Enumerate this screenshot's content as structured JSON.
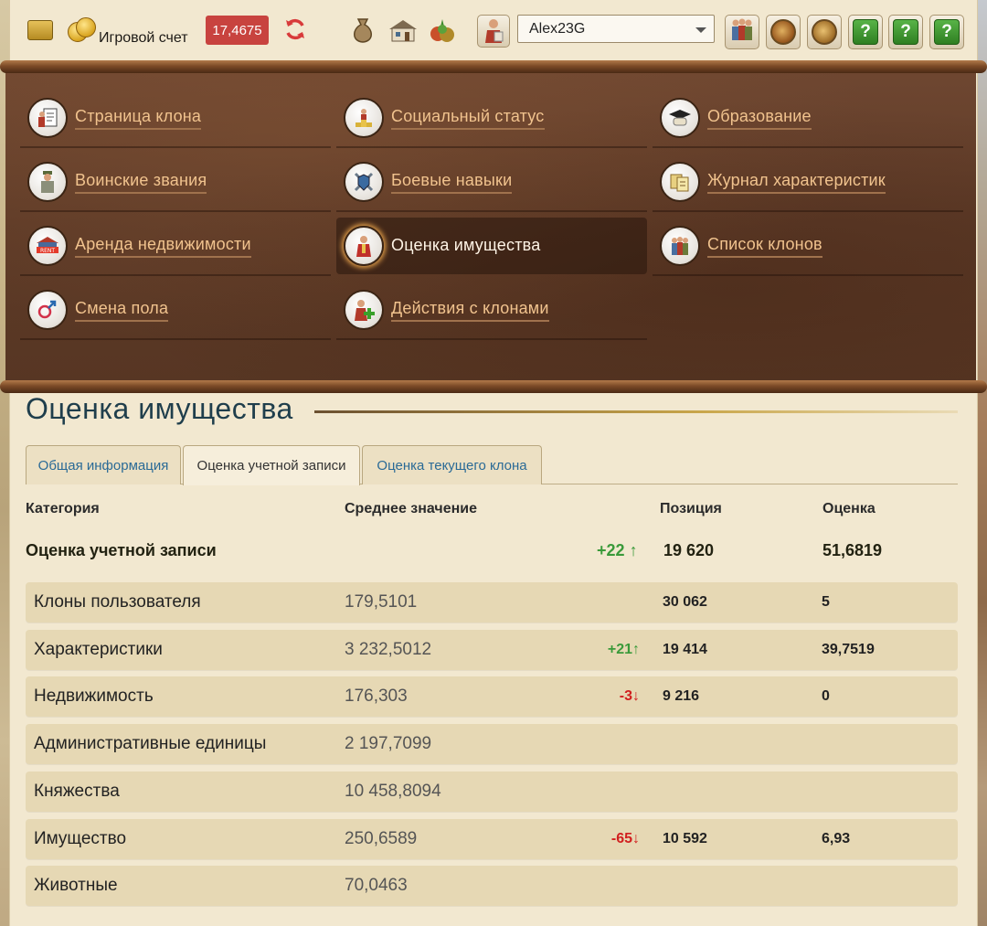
{
  "toolbar": {
    "account_label": "Игровой счет",
    "balance": "17,4675",
    "refresh_icon": "refresh-icon",
    "clone_name": "Alex23G",
    "help_icon_text": "?"
  },
  "menu": {
    "items": [
      {
        "label": "Страница клона",
        "icon": "clone-page-icon"
      },
      {
        "label": "Социальный статус",
        "icon": "social-status-icon"
      },
      {
        "label": "Образование",
        "icon": "education-icon"
      },
      {
        "label": "Воинские звания",
        "icon": "military-rank-icon"
      },
      {
        "label": "Боевые навыки",
        "icon": "combat-skills-icon"
      },
      {
        "label": "Журнал характеристик",
        "icon": "stats-journal-icon"
      },
      {
        "label": "Аренда недвижимости",
        "icon": "rent-icon"
      },
      {
        "label": "Оценка имущества",
        "icon": "property-valuation-icon",
        "active": true
      },
      {
        "label": "Список клонов",
        "icon": "clone-list-icon"
      },
      {
        "label": "Смена пола",
        "icon": "gender-change-icon"
      },
      {
        "label": "Действия с клонами",
        "icon": "clone-actions-icon"
      }
    ]
  },
  "page": {
    "title": "Оценка имущества"
  },
  "tabs": [
    {
      "label": "Общая информация",
      "active": false
    },
    {
      "label": "Оценка учетной записи",
      "active": true
    },
    {
      "label": "Оценка текущего клона",
      "active": false
    }
  ],
  "table": {
    "headers": {
      "category": "Категория",
      "average": "Среднее значение",
      "position": "Позиция",
      "score": "Оценка"
    },
    "summary": {
      "name": "Оценка учетной записи",
      "delta": "+22",
      "delta_dir": "up",
      "position": "19 620",
      "score": "51,6819"
    },
    "rows": [
      {
        "name": "Клоны пользователя",
        "average": "179,5101",
        "delta": "",
        "delta_dir": "",
        "position": "30 062",
        "score": "5"
      },
      {
        "name": "Характеристики",
        "average": "3 232,5012",
        "delta": "+21",
        "delta_dir": "up",
        "position": "19 414",
        "score": "39,7519"
      },
      {
        "name": "Недвижимость",
        "average": "176,303",
        "delta": "-3",
        "delta_dir": "down",
        "position": "9 216",
        "score": "0"
      },
      {
        "name": "Административные единицы",
        "average": "2 197,7099",
        "delta": "",
        "delta_dir": "",
        "position": "",
        "score": ""
      },
      {
        "name": "Княжества",
        "average": "10 458,8094",
        "delta": "",
        "delta_dir": "",
        "position": "",
        "score": ""
      },
      {
        "name": "Имущество",
        "average": "250,6589",
        "delta": "-65",
        "delta_dir": "down",
        "position": "10 592",
        "score": "6,93"
      },
      {
        "name": "Животные",
        "average": "70,0463",
        "delta": "",
        "delta_dir": "",
        "position": "",
        "score": ""
      }
    ]
  },
  "colors": {
    "accent_link": "#f1c38e",
    "title": "#1f3e4c",
    "balance_bg": "#c8433f",
    "up": "#3a9a3a",
    "down": "#d11f1f"
  }
}
